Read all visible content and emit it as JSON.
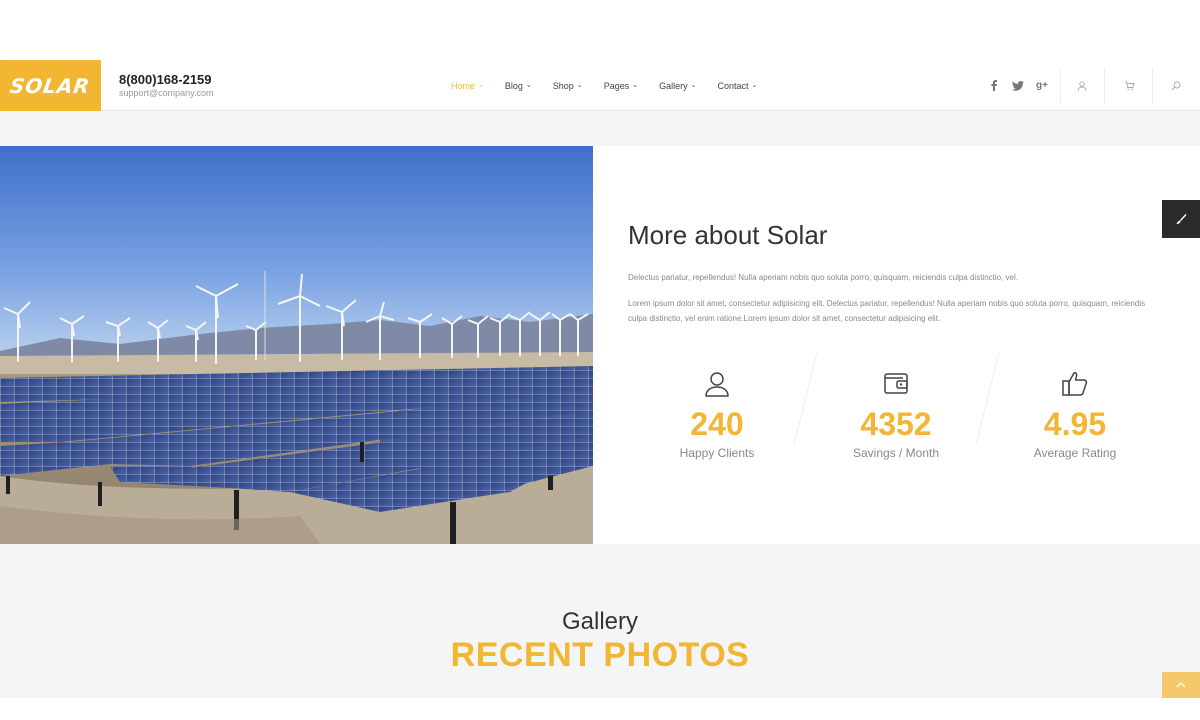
{
  "brand": {
    "logo_text": "SOLAR",
    "accent_color": "#f2b632"
  },
  "header": {
    "phone": "8(800)168-2159",
    "email": "support@company.com"
  },
  "nav": {
    "items": [
      {
        "label": "Home",
        "active": true
      },
      {
        "label": "Blog"
      },
      {
        "label": "Shop"
      },
      {
        "label": "Pages"
      },
      {
        "label": "Gallery"
      },
      {
        "label": "Contact"
      }
    ],
    "chevron": "⌄"
  },
  "socials": {
    "facebook": "f",
    "twitter": "t",
    "googleplus": "g+"
  },
  "about": {
    "title": "More about Solar",
    "p1": "Delectus pariatur, repellendus! Nulla aperiam nobis quo soluta porro, quisquam, reiciendis culpa distinctio, vel.",
    "p2": "Lorem ipsum dolor sit amet, consectetur adipisicing elit. Delectus pariatur, repellendus! Nulla aperiam nobis quo soluta porro, quisquam, reiciendis culpa distinctio, vel enim ratione.Lorem ipsum dolor sit amet, consectetur adipisicing elit.",
    "stats": [
      {
        "value": "240",
        "label": "Happy Clients",
        "icon": "user-icon"
      },
      {
        "value": "4352",
        "label": "Savings / Month",
        "icon": "wallet-icon"
      },
      {
        "value": "4.95",
        "label": "Average Rating",
        "icon": "thumbs-up-icon"
      }
    ]
  },
  "gallery": {
    "subtitle": "Gallery",
    "title": "RECENT PHOTOS"
  }
}
